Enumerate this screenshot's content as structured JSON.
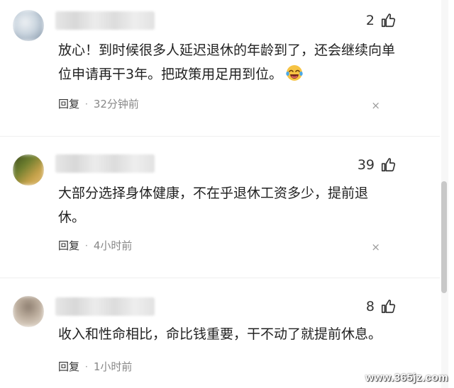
{
  "comments": [
    {
      "likes": "2",
      "text": "放心！到时候很多人延迟退休的年龄到了，还会继续向单位申请再干3年。把政策用足用到位。",
      "has_emoji": true,
      "emoji": "laughing-tears-emoji",
      "reply_label": "回复",
      "separator": "·",
      "time": "32分钟前",
      "close_glyph": "×",
      "avatar_colors": [
        "#c9d4de",
        "#7d8fa3",
        "#eef1f4"
      ]
    },
    {
      "likes": "39",
      "text": "大部分选择身体健康，不在乎退休工资多少，提前退休。",
      "has_emoji": false,
      "reply_label": "回复",
      "separator": "·",
      "time": "4小时前",
      "close_glyph": "×",
      "avatar_colors": [
        "#6b7d2e",
        "#c8a24a",
        "#3e4a1c"
      ]
    },
    {
      "likes": "8",
      "text": "收入和性命相比，命比钱重要，干不动了就提前休息。",
      "has_emoji": false,
      "reply_label": "回复",
      "separator": "·",
      "time": "1小时前",
      "close_glyph": "×",
      "avatar_colors": [
        "#b8a999",
        "#d7cbbd",
        "#8d7e70"
      ]
    }
  ],
  "watermark": "www.365jz.com",
  "icons": {
    "like": "thumbs-up-icon",
    "close": "close-icon"
  }
}
